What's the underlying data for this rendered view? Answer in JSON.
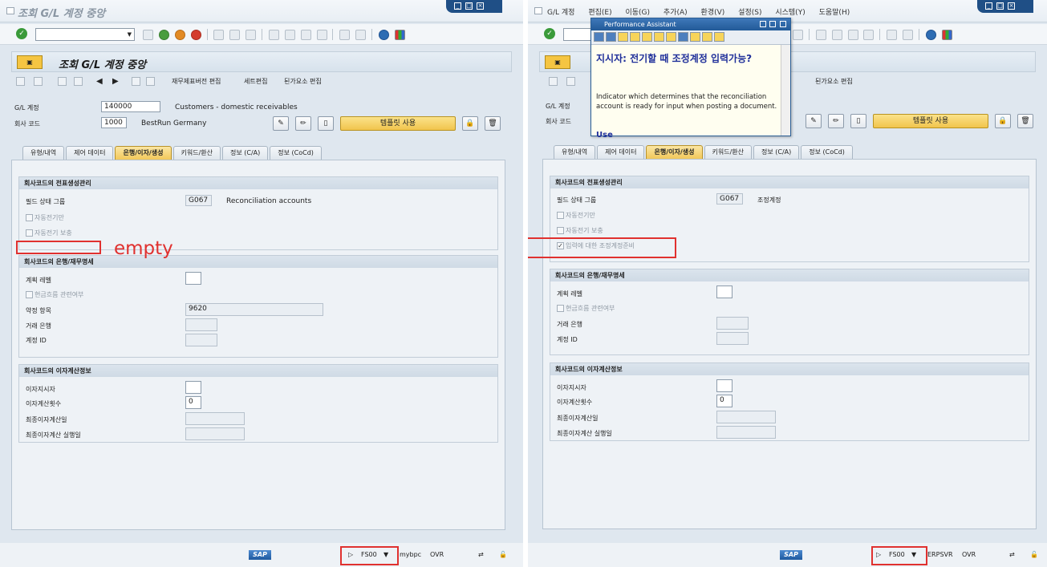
{
  "left": {
    "window_title": "조회 G/L 계정 중앙",
    "header_title": "조회 G/L 계정 중앙",
    "app_toolbar": [
      "재무제표버전 편집",
      "세트편집",
      "된가요소 편집"
    ],
    "gl_account_label": "G/L 계정",
    "gl_account_value": "140000",
    "gl_account_desc": "Customers - domestic receivables",
    "company_code_label": "회사 코드",
    "company_code_value": "1000",
    "company_code_desc": "BestRun Germany",
    "template_button": "템플릿 사용",
    "tabs": [
      "유형/내역",
      "제어 데이터",
      "은행/이자/생성",
      "키워드/환산",
      "정보 (C/A)",
      "정보 (CoCd)"
    ],
    "group1_title": "회사코드의 전표생성관리",
    "field_status_label": "필드 상태 그룹",
    "field_status_value": "G067",
    "field_status_desc": "Reconciliation accounts",
    "cb_auto_post": "자동전기만",
    "cb_auto_post_supp": "자동전기 보충",
    "empty_note": "empty",
    "group2_title": "회사코드의 은행/재무명세",
    "planning_level_label": "계획 레벨",
    "cb_cash_flow": "현금흐름 관련여부",
    "commit_item_label": "약정 항목",
    "commit_item_value": "9620",
    "house_bank_label": "거래 은행",
    "account_id_label": "계정 ID",
    "group3_title": "회사코드의 이자계산정보",
    "interest_ind_label": "이자지시자",
    "interest_freq_label": "이자계산횟수",
    "interest_freq_value": "0",
    "last_calc_label": "최종이자계산일",
    "last_run_label": "최종이자계산 실행일",
    "status_tcode": "FS00",
    "status_server": "mybpc",
    "status_mode": "OVR"
  },
  "right": {
    "menu": [
      "G/L 계정",
      "편집(E)",
      "이동(G)",
      "추가(A)",
      "환경(V)",
      "설정(S)",
      "시스템(Y)",
      "도움말(H)"
    ],
    "app_toolbar": [
      "된가요소 편집"
    ],
    "gl_account_label": "G/L 계정",
    "company_code_label": "회사 코드",
    "template_button": "템플릿 사용",
    "tabs": [
      "유형/내역",
      "제어 데이터",
      "은행/이자/생성",
      "키워드/환산",
      "정보 (C/A)",
      "정보 (CoCd)"
    ],
    "group1_title": "회사코드의 전표생성관리",
    "field_status_label": "필드 상태 그룹",
    "field_status_value": "G067",
    "field_status_desc": "조정계정",
    "cb_auto_post": "자동전기만",
    "cb_auto_post_supp": "자동전기 보충",
    "cb_recon_input": "입력에 대한 조정계정준비",
    "group2_title": "회사코드의 은행/재무명세",
    "planning_level_label": "계획 레벨",
    "cb_cash_flow": "현금흐름 관련여부",
    "house_bank_label": "거래 은행",
    "account_id_label": "계정 ID",
    "group3_title": "회사코드의 이자계산정보",
    "interest_ind_label": "이자지시자",
    "interest_freq_label": "이자계산횟수",
    "interest_freq_value": "0",
    "last_calc_label": "최종이자계산일",
    "last_run_label": "최종이자계산 실행일",
    "status_tcode": "FS00",
    "status_server": "ERPSVR",
    "status_mode": "OVR"
  },
  "assistant": {
    "title": "Performance Assistant",
    "heading": "지시자: 전기할 때 조정계정 입력가능?",
    "text": "Indicator which determines that the reconciliation account is ready for input when posting a document.",
    "use_heading": "Use"
  },
  "sap_logo": "SAP",
  "colors": {
    "highlight": "#e0312f",
    "active_tab": "#f2c85a",
    "assistant_heading": "#1f2f9a"
  }
}
